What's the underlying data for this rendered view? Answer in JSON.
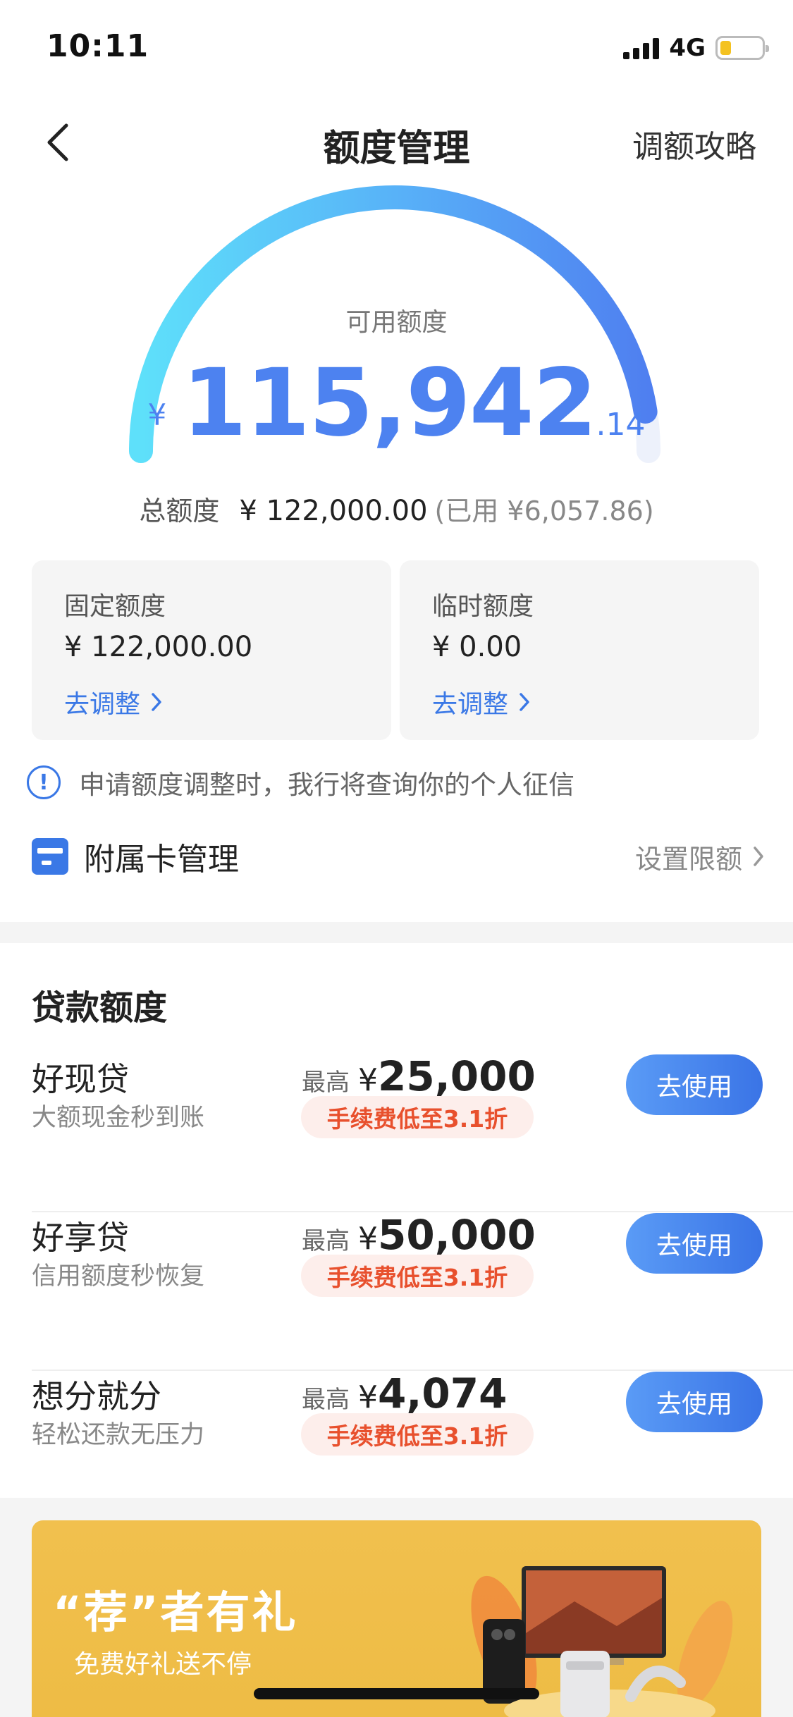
{
  "status_bar": {
    "time": "10:11",
    "network": "4G"
  },
  "nav": {
    "title": "额度管理",
    "right_link": "调额攻略"
  },
  "available": {
    "label": "可用额度",
    "currency": "¥",
    "integer": "115,942",
    "decimal": ".14",
    "fraction_of_total": 0.95
  },
  "total": {
    "label": "总额度",
    "amount": "¥ 122,000.00",
    "used": "(已用 ¥6,057.86)"
  },
  "cards": [
    {
      "title": "固定额度",
      "amount": "¥ 122,000.00",
      "link": "去调整"
    },
    {
      "title": "临时额度",
      "amount": "¥ 0.00",
      "link": "去调整"
    }
  ],
  "notice": "申请额度调整时，我行将查询你的个人征信",
  "sub_card": {
    "label": "附属卡管理",
    "action": "设置限额"
  },
  "loans": {
    "title": "贷款额度",
    "items": [
      {
        "name": "好现贷",
        "desc": "大额现金秒到账",
        "max_label": "最高",
        "max_value": "25,000",
        "fee": "手续费低至3.1折",
        "button": "去使用"
      },
      {
        "name": "好享贷",
        "desc": "信用额度秒恢复",
        "max_label": "最高",
        "max_value": "50,000",
        "fee": "手续费低至3.1折",
        "button": "去使用"
      },
      {
        "name": "想分就分",
        "desc": "轻松还款无压力",
        "max_label": "最高",
        "max_value": "4,074",
        "fee": "手续费低至3.1折",
        "button": "去使用"
      }
    ]
  },
  "banner": {
    "title": "“荐”者有礼",
    "subtitle": "免费好礼送不停"
  },
  "colors": {
    "accent": "#4d82f0",
    "fee_red": "#e8502d",
    "banner_yellow": "#f1c04e"
  }
}
